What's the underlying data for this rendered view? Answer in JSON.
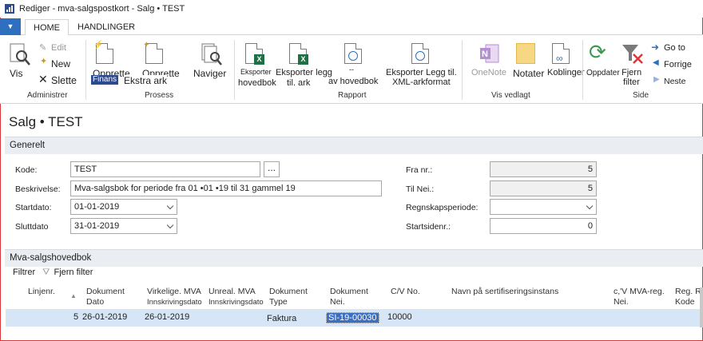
{
  "window": {
    "title": "Rediger - mva-salgspostkort -  Salg • TEST"
  },
  "ribbon": {
    "tabs": [
      {
        "label": "HOME"
      },
      {
        "label": "HANDLINGER"
      }
    ],
    "groups": {
      "administrer": {
        "label": "Administrer",
        "vis": "Vis",
        "edit": "Edit",
        "new": "New",
        "delete": "Slette"
      },
      "prosess": {
        "label": "Prosess",
        "opprette1": "Opprette",
        "opprette2": "Opprette",
        "finans": "Finans",
        "ekstra_ark": "Ekstra ark",
        "naviger": "Naviger"
      },
      "rapport": {
        "label": "Rapport",
        "eksporter_small": "Eksporter",
        "hovedbok": "hovedbok",
        "eksporter_legg": "Eksporter legg",
        "til_ark": "til. ark",
        "dash": "--",
        "av_hovedbok": "av hovedbok",
        "xml_line1": "Eksporter Legg til.",
        "xml_line2": "XML-arkformat"
      },
      "vis_vedlagt": {
        "label": "Vis vedlagt",
        "onenote": "OneNote",
        "notater": "Notater",
        "koblinger": "Koblinger"
      },
      "side": {
        "label": "Side",
        "oppdater": "Oppdater",
        "fjern_filter_1": "Fjern",
        "fjern_filter_2": "filter",
        "goto": "Go to",
        "forrige": "Forrige",
        "neste": "Neste"
      }
    }
  },
  "page": {
    "title": "Salg • TEST"
  },
  "generelt": {
    "header": "Generelt",
    "kode": {
      "label": "Kode:",
      "value": "TEST",
      "lookup": "..."
    },
    "beskrivelse": {
      "label": "Beskrivelse:",
      "value": "Mva-salgsbok for periode fra 01 •01 •19 til 31 gammel 19"
    },
    "startdato": {
      "label": "Startdato:",
      "value": "01-01-2019"
    },
    "sluttdato": {
      "label": "Sluttdato",
      "value": "31-01-2019"
    },
    "fra_nr": {
      "label": "Fra nr.:",
      "value": "5"
    },
    "til_nr": {
      "label": "Til Nei.:",
      "value": "5"
    },
    "regnskapsperiode": {
      "label": "Regnskapsperiode:",
      "value": ""
    },
    "startsidenr": {
      "label": "Startsidenr.:",
      "value": "0"
    }
  },
  "hovedbok": {
    "header": "Mva-salgshovedbok",
    "filter_label": "Filtrer",
    "clear_filter": "Fjern filter",
    "columns": [
      {
        "l1": "Linjenr.",
        "l2": ""
      },
      {
        "l1": "Dokument",
        "l2": "Dato"
      },
      {
        "l1": "Virkelige. MVA",
        "l2": "Innskrivingsdato"
      },
      {
        "l1": "Unreal. MVA",
        "l2": "Innskrivingsdato"
      },
      {
        "l1": "Dokument",
        "l2": "Type"
      },
      {
        "l1": "Dokument",
        "l2": "Nei."
      },
      {
        "l1": "C/V No.",
        "l2": ""
      },
      {
        "l1": "Navn på sertifiseringsinstans",
        "l2": ""
      },
      {
        "l1": "c,'V MVA-reg.",
        "l2": "Nei."
      },
      {
        "l1": "Reg. Re",
        "l2": "Kode"
      }
    ],
    "rows": [
      {
        "linjenr": "5",
        "dato": "26-01-2019",
        "virk_dato": "26-01-2019",
        "unreal_dato": "",
        "type": "Faktura",
        "nr": "SI-19-00030",
        "cv_no": "10000"
      }
    ]
  },
  "colors": {
    "accent": "#2e6fbf",
    "frame": "#d8383b",
    "row_highlight": "#d6e6f7",
    "section_bg": "#eaeef3"
  }
}
